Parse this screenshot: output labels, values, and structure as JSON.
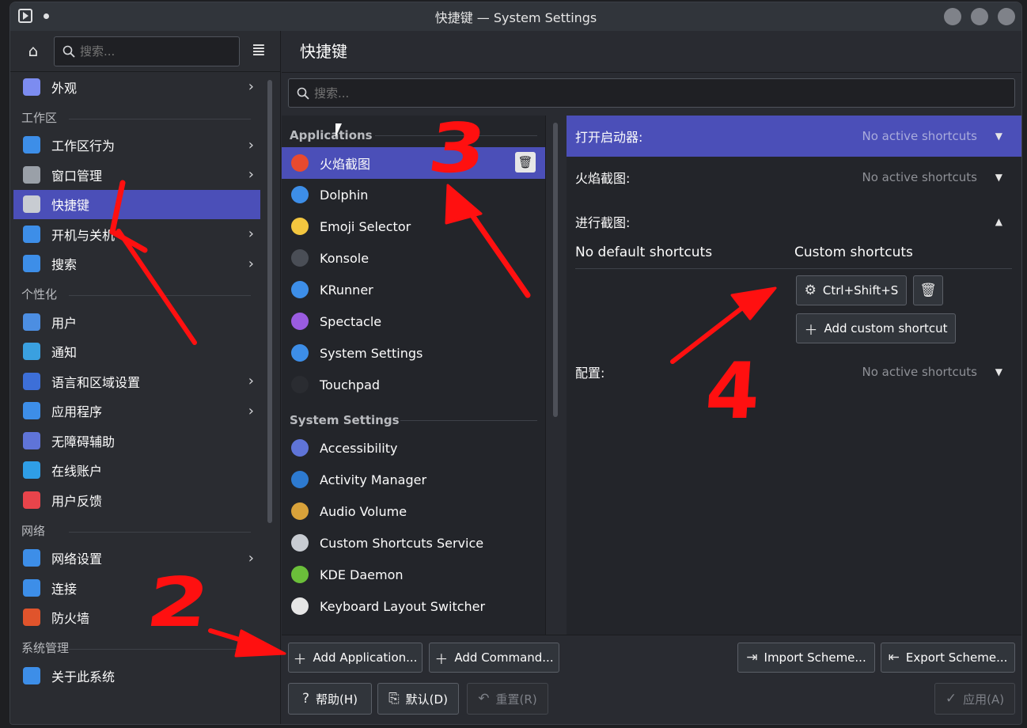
{
  "window": {
    "title": "快捷键 — System Settings"
  },
  "sidebar": {
    "search_placeholder": "搜索...",
    "items": [
      {
        "type": "item",
        "label": "外观",
        "icon": "appearance-icon",
        "chevron": true,
        "color": "#7c8cf0"
      },
      {
        "type": "section",
        "label": "工作区"
      },
      {
        "type": "item",
        "label": "工作区行为",
        "icon": "workspace-icon",
        "chevron": true,
        "color": "#3d8ee8"
      },
      {
        "type": "item",
        "label": "窗口管理",
        "icon": "window-icon",
        "chevron": true,
        "color": "#9aa0a8"
      },
      {
        "type": "item",
        "label": "快捷键",
        "icon": "keyboard-icon",
        "chevron": false,
        "active": true,
        "color": "#c8ccd2"
      },
      {
        "type": "item",
        "label": "开机与关机",
        "icon": "power-icon",
        "chevron": true,
        "color": "#3d8ee8"
      },
      {
        "type": "item",
        "label": "搜索",
        "icon": "search-icon",
        "chevron": true,
        "color": "#3d8ee8"
      },
      {
        "type": "section",
        "label": "个性化"
      },
      {
        "type": "item",
        "label": "用户",
        "icon": "user-icon",
        "chevron": false,
        "color": "#4c8ee2"
      },
      {
        "type": "item",
        "label": "通知",
        "icon": "notification-icon",
        "chevron": false,
        "color": "#3aa0e0"
      },
      {
        "type": "item",
        "label": "语言和区域设置",
        "icon": "language-icon",
        "chevron": true,
        "color": "#3d6fd8"
      },
      {
        "type": "item",
        "label": "应用程序",
        "icon": "applications-icon",
        "chevron": true,
        "color": "#3d8ee8"
      },
      {
        "type": "item",
        "label": "无障碍辅助",
        "icon": "accessibility-icon",
        "chevron": false,
        "color": "#5f74d8"
      },
      {
        "type": "item",
        "label": "在线账户",
        "icon": "cloud-icon",
        "chevron": false,
        "color": "#2f9ee6"
      },
      {
        "type": "item",
        "label": "用户反馈",
        "icon": "feedback-icon",
        "chevron": false,
        "color": "#e8444b"
      },
      {
        "type": "section",
        "label": "网络"
      },
      {
        "type": "item",
        "label": "网络设置",
        "icon": "network-icon",
        "chevron": true,
        "color": "#3d8ee8"
      },
      {
        "type": "item",
        "label": "连接",
        "icon": "connection-icon",
        "chevron": false,
        "color": "#3d8ee8"
      },
      {
        "type": "item",
        "label": "防火墙",
        "icon": "firewall-icon",
        "chevron": false,
        "color": "#e0542c"
      },
      {
        "type": "section",
        "label": "系统管理"
      },
      {
        "type": "item",
        "label": "关于此系统",
        "icon": "info-icon",
        "chevron": false,
        "color": "#3d8ee8"
      }
    ]
  },
  "main": {
    "title": "快捷键",
    "search_placeholder": "搜索...",
    "app_list": [
      {
        "type": "section",
        "label": "Applications"
      },
      {
        "type": "item",
        "label": "火焰截图",
        "icon": "flameshot-icon",
        "active": true,
        "color": "#e84a2f"
      },
      {
        "type": "item",
        "label": "Dolphin",
        "icon": "folder-icon",
        "color": "#3d8ee8"
      },
      {
        "type": "item",
        "label": "Emoji Selector",
        "icon": "emoji-icon",
        "color": "#f3c63f"
      },
      {
        "type": "item",
        "label": "Konsole",
        "icon": "terminal-icon",
        "color": "#4a4e56"
      },
      {
        "type": "item",
        "label": "KRunner",
        "icon": "krunner-icon",
        "color": "#3d8ee8"
      },
      {
        "type": "item",
        "label": "Spectacle",
        "icon": "spectacle-icon",
        "color": "#9a5ce0"
      },
      {
        "type": "item",
        "label": "System Settings",
        "icon": "system-settings-icon",
        "color": "#3d8ee8"
      },
      {
        "type": "item",
        "label": "Touchpad",
        "icon": "touchpad-icon",
        "color": "#2a2c31"
      },
      {
        "type": "section",
        "label": "System Settings"
      },
      {
        "type": "item",
        "label": "Accessibility",
        "icon": "accessibility-icon",
        "color": "#5f74d8"
      },
      {
        "type": "item",
        "label": "Activity Manager",
        "icon": "activity-icon",
        "color": "#2d7ad0"
      },
      {
        "type": "item",
        "label": "Audio Volume",
        "icon": "audio-icon",
        "color": "#d9a23a"
      },
      {
        "type": "item",
        "label": "Custom Shortcuts Service",
        "icon": "keyboard-icon",
        "color": "#c8ccd2"
      },
      {
        "type": "item",
        "label": "KDE Daemon",
        "icon": "daemon-icon",
        "color": "#6bbf3a"
      },
      {
        "type": "item",
        "label": "Keyboard Layout Switcher",
        "icon": "keyboard-layout-icon",
        "color": "#e6e6e6"
      }
    ],
    "shortcuts": [
      {
        "name": "打开启动器:",
        "state": "No active shortcuts",
        "expanded": false,
        "active": true
      },
      {
        "name": "火焰截图:",
        "state": "No active shortcuts",
        "expanded": false
      },
      {
        "name": "进行截图:",
        "state": "",
        "expanded": true
      },
      {
        "name": "配置:",
        "state": "No active shortcuts",
        "expanded": false
      }
    ],
    "expanded": {
      "default_header": "No default shortcuts",
      "custom_header": "Custom shortcuts",
      "custom_shortcut": "Ctrl+Shift+S",
      "add_custom_label": "Add custom shortcut"
    },
    "buttons": {
      "add_application": "Add Application...",
      "add_command": "Add Command...",
      "import_scheme": "Import Scheme...",
      "export_scheme": "Export Scheme...",
      "help": "帮助(H)",
      "defaults": "默认(D)",
      "reset": "重置(R)",
      "apply": "应用(A)"
    }
  },
  "annotations": {
    "numbers": [
      "2",
      "3",
      "4"
    ],
    "color": "#ff1010"
  }
}
